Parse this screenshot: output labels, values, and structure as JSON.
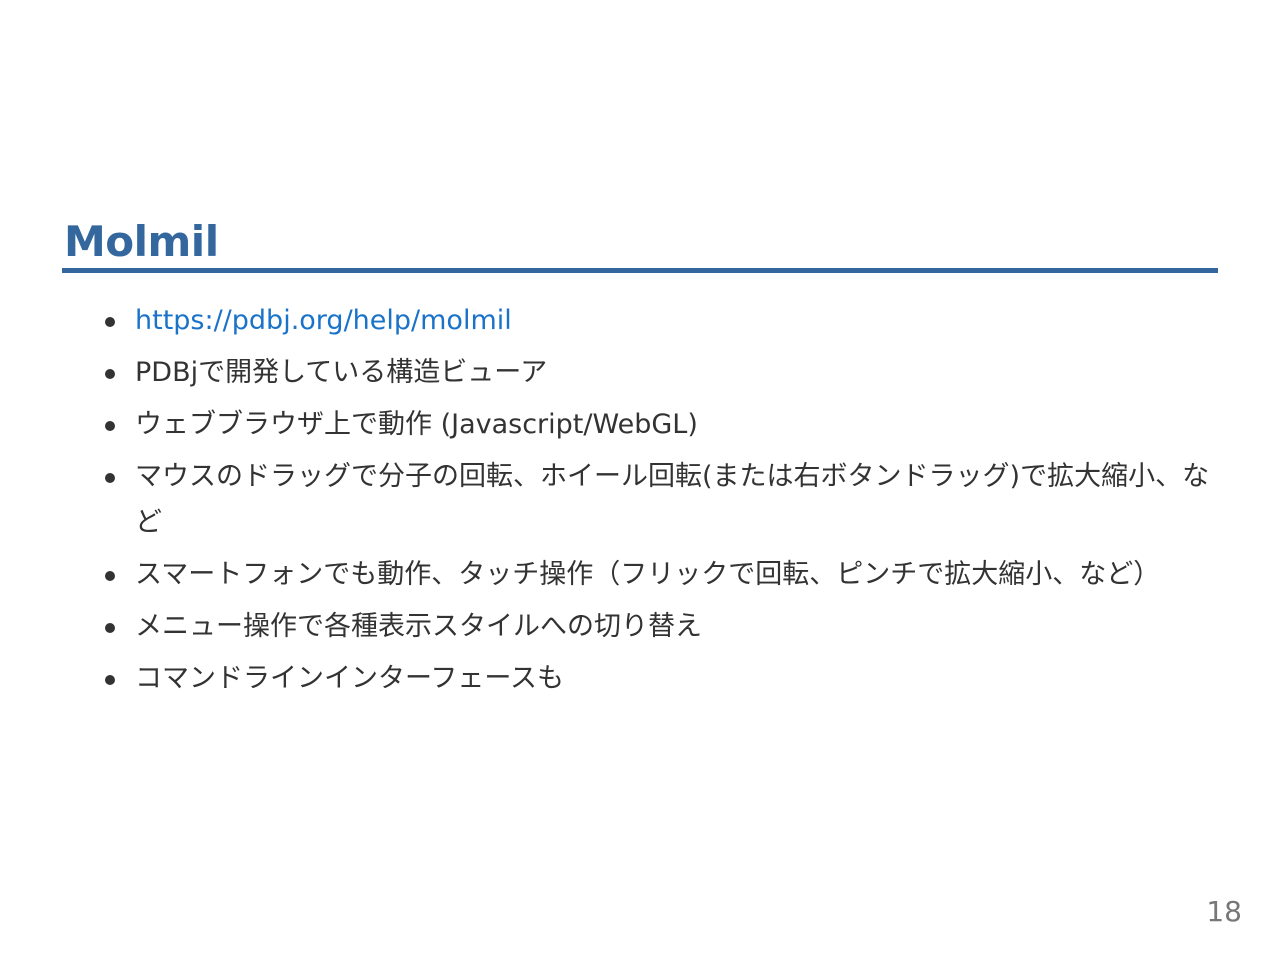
{
  "slide": {
    "title": "Molmil",
    "bullets": [
      {
        "text": "https://pdbj.org/help/molmil",
        "is_link": true
      },
      {
        "text": "PDBjで開発している構造ビューア",
        "is_link": false
      },
      {
        "text": "ウェブブラウザ上で動作 (Javascript/WebGL)",
        "is_link": false
      },
      {
        "text": "マウスのドラッグで分子の回転、ホイール回転(または右ボタンドラッグ)で拡大縮小、など",
        "is_link": false
      },
      {
        "text": "スマートフォンでも動作、タッチ操作（フリックで回転、ピンチで拡大縮小、など）",
        "is_link": false
      },
      {
        "text": "メニュー操作で各種表示スタイルへの切り替え",
        "is_link": false
      },
      {
        "text": "コマンドラインインターフェースも",
        "is_link": false
      }
    ],
    "page_number": "18"
  },
  "colors": {
    "title": "#33679e",
    "link": "#1a73c8",
    "text": "#333333",
    "page_number": "#777777"
  }
}
